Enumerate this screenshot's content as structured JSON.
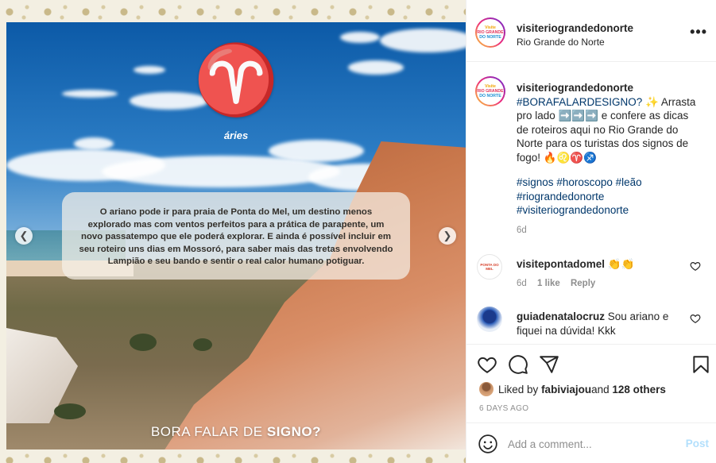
{
  "post": {
    "media": {
      "sign_symbol": "♈",
      "sign_label": "áries",
      "caption_box": "O ariano pode ir para praia de Ponta do Mel, um destino menos explorado mas com ventos perfeitos para a prática de parapente, um novo passatempo que ele poderá explorar. E ainda é possível incluir em seu roteiro uns dias em Mossoró, para saber mais das tretas envolvendo Lampião e seu bando e sentir o real calor humano potiguar.",
      "bottom_text_normal": "BORA FALAR DE ",
      "bottom_text_bold": "SIGNO?",
      "prev_icon": "chevron-left-icon",
      "next_icon": "chevron-right-icon"
    },
    "header": {
      "username": "visiteriograndedonorte",
      "location": "Rio Grande do Norte",
      "more": "•••",
      "avatar_text": [
        "Visite",
        "RIO GRANDE",
        "DO NORTE"
      ]
    },
    "caption": {
      "username": "visiteriograndedonorte",
      "hashtag_main": "#BORAFALARDESIGNO?",
      "text_1": " ✨ Arrasta pro lado ➡️➡️➡️ e confere as dicas de roteiros aqui no Rio Grande do Norte para os turistas dos signos de fogo! 🔥♌♈♐",
      "hashtags": [
        "#signos",
        "#horoscopo",
        "#leão",
        "#riograndedonorte",
        "#visiteriograndedonorte"
      ],
      "age": "6d"
    },
    "comments": [
      {
        "username": "visitepontadomel",
        "text": " 👏👏",
        "age": "6d",
        "likes": "1 like",
        "reply": "Reply",
        "avatar_text": "PONTA DO MEL"
      },
      {
        "username": "guiadenatalocruz",
        "text": " Sou ariano e fiquei na dúvida! Kkk"
      }
    ],
    "actions": {
      "icons": [
        "heart-icon",
        "comment-icon",
        "share-icon",
        "bookmark-icon"
      ]
    },
    "likes": {
      "prefix": "Liked by ",
      "user": "fabiviajou",
      "middle": " and ",
      "others": "128 others"
    },
    "date": "6 DAYS AGO",
    "add_comment": {
      "placeholder": "Add a comment...",
      "post_label": "Post"
    }
  },
  "colors": {
    "link": "#00376b",
    "muted": "#8e8e8e",
    "post_disabled": "#b2dffc",
    "border": "#efefef"
  }
}
